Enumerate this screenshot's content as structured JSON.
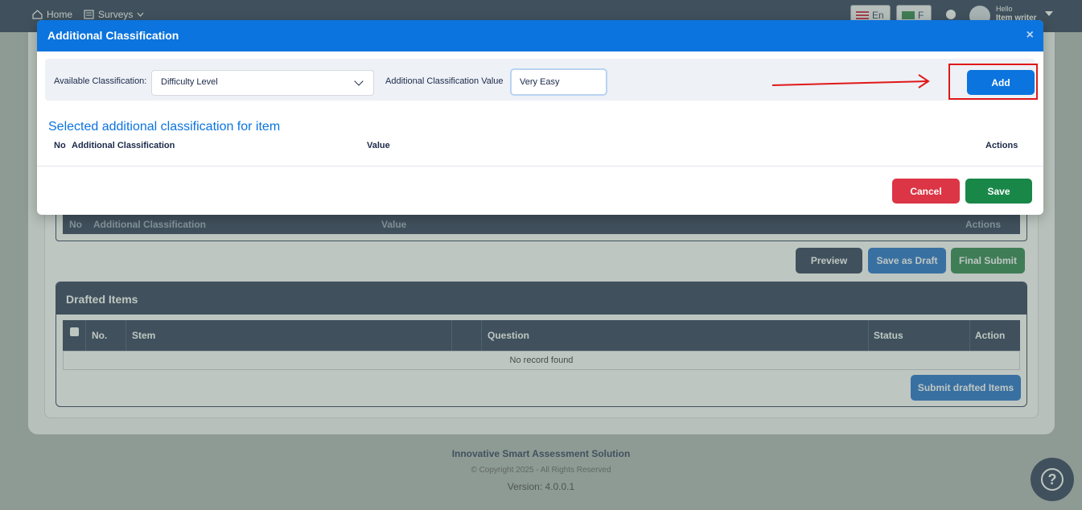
{
  "topbar": {
    "home_label": "Home",
    "surveys_label": "Surveys",
    "lang_en": "En",
    "lang_other": "F",
    "hello": "Hello",
    "username": "Item writer"
  },
  "background": {
    "inner_table_cols": [
      "No",
      "Additional Classification",
      "Value",
      "Actions"
    ],
    "preview_label": "Preview",
    "save_draft_label": "Save as Draft",
    "final_submit_label": "Final Submit",
    "drafted": {
      "title": "Drafted Items",
      "columns": [
        "No.",
        "Stem",
        "Question",
        "Status",
        "Action"
      ],
      "empty": "No record found",
      "submit_label": "Submit drafted Items"
    }
  },
  "footer": {
    "line1": "Innovative Smart Assessment Solution",
    "line2": "© Copyright 2025 - All Rights Reserved",
    "line3": "Version: 4.0.0.1"
  },
  "help_icon": "?",
  "modal": {
    "title": "Additional Classification",
    "close_icon": "×",
    "available_label": "Available Classification:",
    "available_value": "Difficulty Level",
    "value_label": "Additional Classification Value",
    "value_input": "Very Easy",
    "add_label": "Add",
    "section_title": "Selected additional classification for item",
    "columns": {
      "no": "No",
      "classification": "Additional Classification",
      "value": "Value",
      "actions": "Actions"
    },
    "cancel_label": "Cancel",
    "save_label": "Save"
  },
  "colors": {
    "primary": "#0b74de",
    "navy": "#1b2a4a",
    "danger": "#dc3545",
    "success": "#198748",
    "annotation": "#e01818"
  }
}
